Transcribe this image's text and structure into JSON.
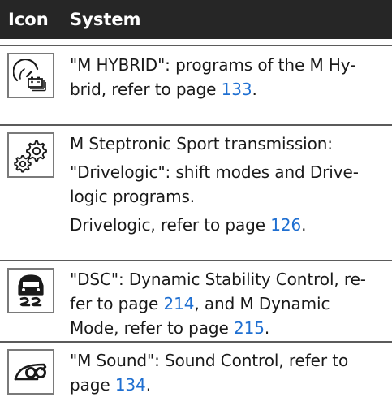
{
  "header": {
    "icon_label": "Icon",
    "system_label": "System"
  },
  "rows": [
    {
      "icon": "m-hybrid-icon",
      "line1_pre": "\"M HYBRID\": programs of the M Hy-",
      "line2_pre": "brid, refer to page ",
      "line2_link": "133",
      "line2_post": "."
    },
    {
      "icon": "drivelogic-gears-icon",
      "p1_line1": "M Steptronic Sport transmission:",
      "p2_line1": "\"Drivelogic\": shift modes and Drive-",
      "p2_line2": "logic programs.",
      "p3_pre": "Drivelogic, refer to page ",
      "p3_link": "126",
      "p3_post": "."
    },
    {
      "icon": "dsc-skid-icon",
      "line1": "\"DSC\": Dynamic Stability Control, re-",
      "line2_pre": "fer to page ",
      "line2_link": "214",
      "line2_post": ", and M Dynamic",
      "line3_pre": "Mode, refer to page ",
      "line3_link": "215",
      "line3_post": "."
    },
    {
      "icon": "m-sound-icon",
      "line1": "\"M Sound\": Sound Control, refer to",
      "line2_pre": "page ",
      "line2_link": "134",
      "line2_post": "."
    }
  ],
  "colors": {
    "header_bg": "#262626",
    "link": "#1f6fd1",
    "divider": "#5b5b5b"
  }
}
